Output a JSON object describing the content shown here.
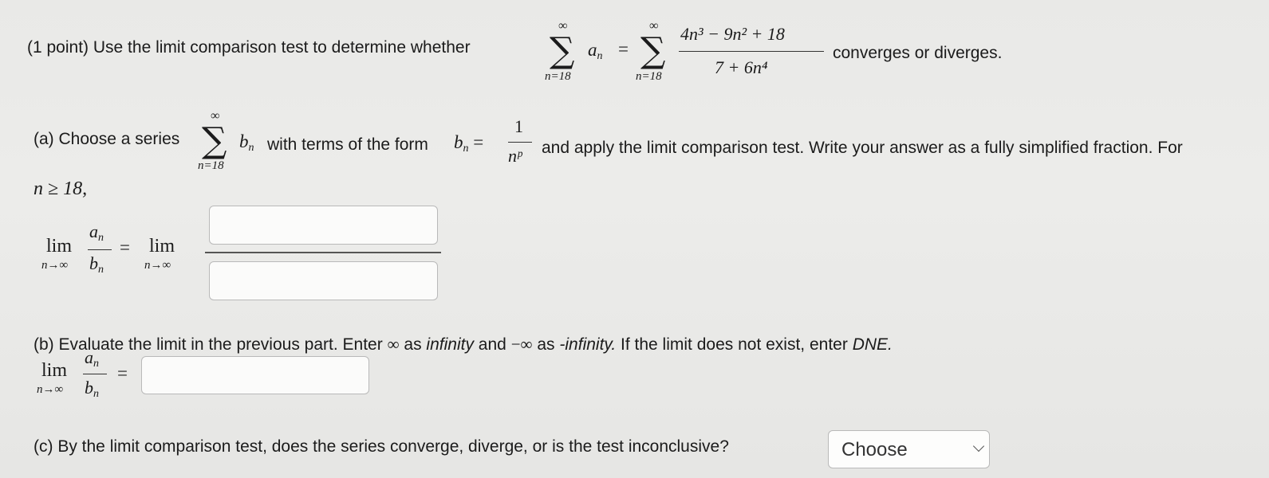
{
  "problem": {
    "intro": "(1 point) Use the limit comparison test to determine whether",
    "outro": "converges or diverges.",
    "sum_upper": "∞",
    "sum_lower": "n=18",
    "term_a": "a",
    "term_a_sub": "n",
    "equals": "=",
    "numerator": "4n³ − 9n² + 18",
    "denominator": "7 + 6n⁴"
  },
  "part_a": {
    "label": "(a) Choose a series",
    "sum_upper": "∞",
    "sum_lower": "n=18",
    "middle": "with terms of the form",
    "bn_numerator": "1",
    "bn_denominator": "nᵖ",
    "after": "and apply the limit comparison test. Write your answer as a fully simplified fraction. For",
    "condition": "n ≥ 18,",
    "lim": "lim",
    "lim_sub": "n→∞",
    "numerator_value": "",
    "denominator_value": ""
  },
  "part_b": {
    "label": "(b) Evaluate the limit in the previous part. Enter",
    "inf_symbol": "∞",
    "as1": "as",
    "infinity_word": "infinity",
    "and": "and",
    "neg_inf": "−∞",
    "as2": "as",
    "neg_infinity_word": "-infinity.",
    "rest": "If the limit does not exist, enter",
    "dne": "DNE.",
    "lim": "lim",
    "lim_sub": "n→∞",
    "answer_value": ""
  },
  "part_c": {
    "label": "(c) By the limit comparison test, does the series converge, diverge, or is the test inconclusive?",
    "select_value": "Choose"
  }
}
